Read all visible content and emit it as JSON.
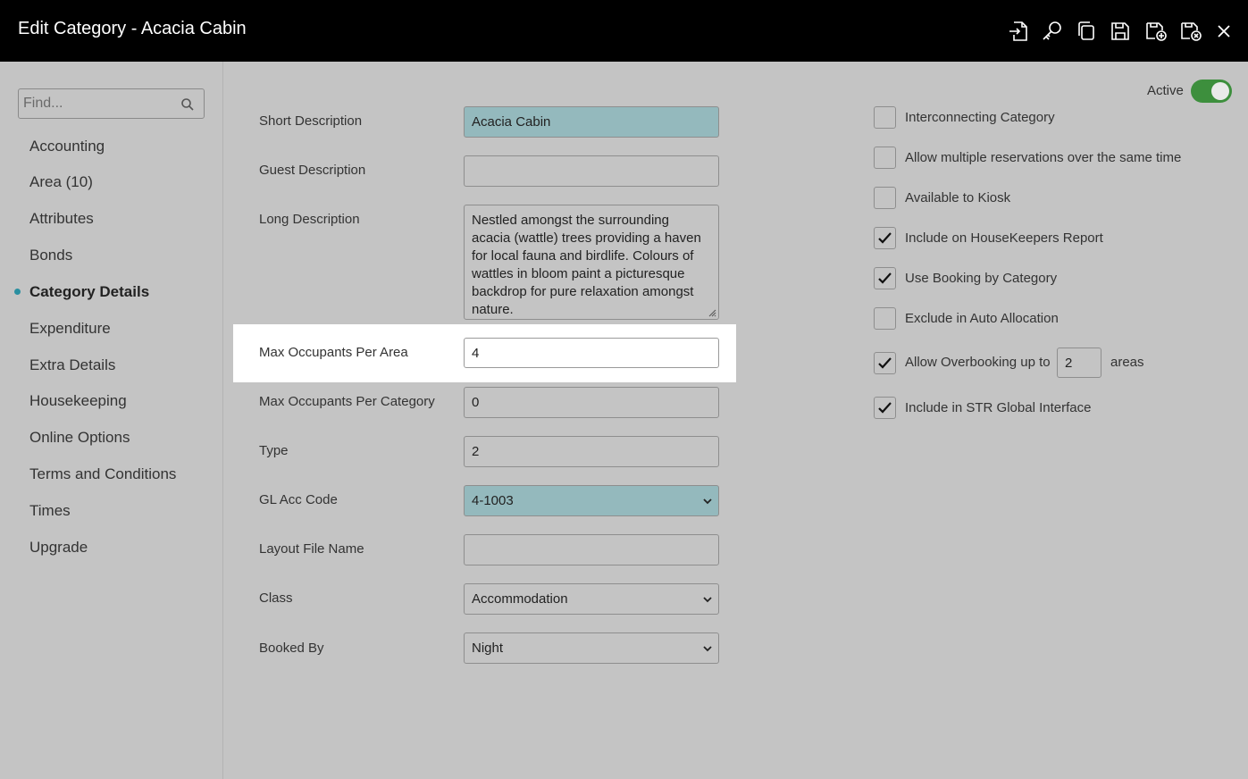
{
  "header": {
    "title": "Edit Category - Acacia Cabin"
  },
  "toolbar": {
    "icons": [
      "exit-icon",
      "key-icon",
      "copy-icon",
      "save-icon",
      "save-new-icon",
      "save-close-icon",
      "close-icon"
    ]
  },
  "sidebar": {
    "search_placeholder": "Find...",
    "items": [
      {
        "label": "Accounting"
      },
      {
        "label": "Area (10)"
      },
      {
        "label": "Attributes"
      },
      {
        "label": "Bonds"
      },
      {
        "label": "Category Details"
      },
      {
        "label": "Expenditure"
      },
      {
        "label": "Extra Details"
      },
      {
        "label": "Housekeeping"
      },
      {
        "label": "Online Options"
      },
      {
        "label": "Terms and Conditions"
      },
      {
        "label": "Times"
      },
      {
        "label": "Upgrade"
      }
    ],
    "active_index": 4
  },
  "form": {
    "short_description": {
      "label": "Short Description",
      "value": "Acacia Cabin"
    },
    "guest_description": {
      "label": "Guest Description",
      "value": ""
    },
    "long_description": {
      "label": "Long Description",
      "value": "Nestled amongst the surrounding acacia (wattle) trees providing a haven for local fauna and birdlife. Colours of wattles in bloom paint a picturesque backdrop for pure relaxation amongst nature."
    },
    "max_occupants_area": {
      "label": "Max Occupants Per Area",
      "value": "4"
    },
    "max_occupants_category": {
      "label": "Max Occupants Per Category",
      "value": "0"
    },
    "type": {
      "label": "Type",
      "value": "2"
    },
    "gl_acc_code": {
      "label": "GL Acc Code",
      "value": "4-1003"
    },
    "layout_file_name": {
      "label": "Layout File Name",
      "value": ""
    },
    "class": {
      "label": "Class",
      "value": "Accommodation"
    },
    "booked_by": {
      "label": "Booked By",
      "value": "Night"
    }
  },
  "active_toggle": {
    "label": "Active",
    "on": true
  },
  "checkboxes": [
    {
      "label": "Interconnecting Category",
      "checked": false
    },
    {
      "label": "Allow multiple reservations over the same time",
      "checked": false
    },
    {
      "label": "Available to Kiosk",
      "checked": false
    },
    {
      "label": "Include on HouseKeepers Report",
      "checked": true
    },
    {
      "label": "Use Booking by Category",
      "checked": true
    },
    {
      "label": "Exclude in Auto Allocation",
      "checked": false
    },
    {
      "label": "Allow Overbooking up to",
      "checked": true
    },
    {
      "label": "Include in STR Global Interface",
      "checked": true
    }
  ],
  "overbooking": {
    "value": "2",
    "suffix": "areas"
  },
  "colors": {
    "accent": "#2a8fa0",
    "toggle_on": "#3d8f3d",
    "teal_field": "#94b9bd"
  }
}
